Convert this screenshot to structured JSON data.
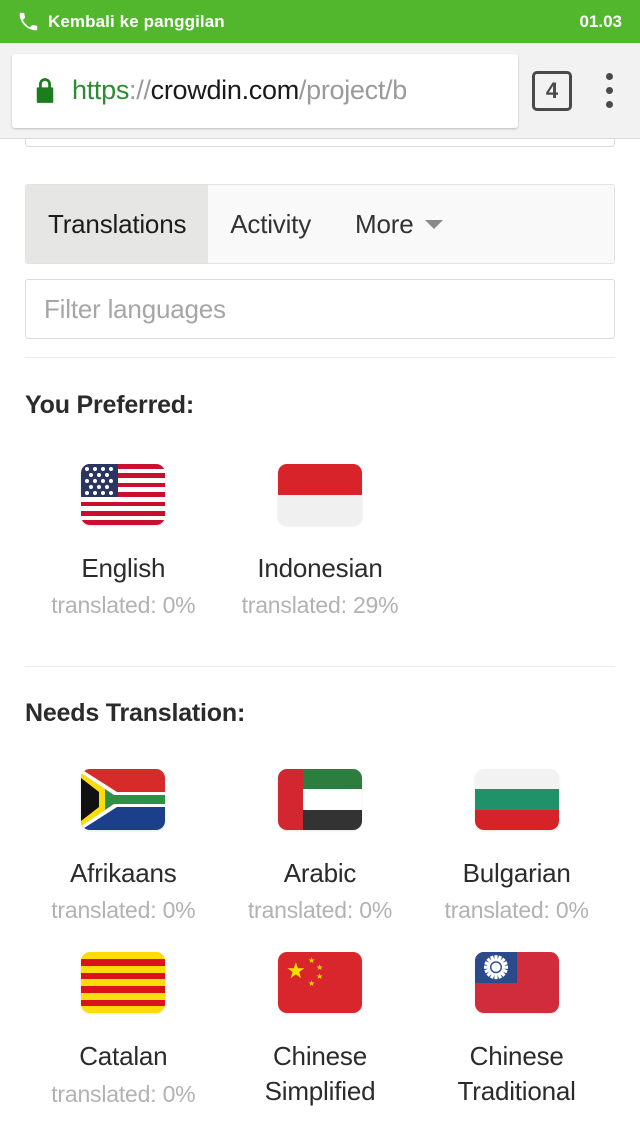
{
  "call_banner": {
    "icon": "phone-icon",
    "label": "Kembali ke panggilan",
    "time": "01.03",
    "color": "#52b72c"
  },
  "browser": {
    "lock_icon": "lock-icon",
    "url": {
      "scheme": "https",
      "separator": "://",
      "host": "crowdin.com",
      "path": "/project/b"
    },
    "tab_count": "4",
    "overflow_icon": "more-vertical-icon"
  },
  "tabs": [
    {
      "label": "Translations",
      "active": true
    },
    {
      "label": "Activity",
      "active": false
    },
    {
      "label": "More",
      "active": false,
      "caret": "chevron-down-icon"
    }
  ],
  "filter": {
    "placeholder": "Filter languages",
    "value": ""
  },
  "sections": [
    {
      "title": "You Preferred:",
      "languages": [
        {
          "name": "English",
          "flag": "flag-united-states",
          "progress": "translated: 0%"
        },
        {
          "name": "Indonesian",
          "flag": "flag-indonesia",
          "progress": "translated: 29%"
        }
      ]
    },
    {
      "title": "Needs Translation:",
      "languages": [
        {
          "name": "Afrikaans",
          "flag": "flag-south-africa",
          "progress": "translated: 0%"
        },
        {
          "name": "Arabic",
          "flag": "flag-united-arab-emirates",
          "progress": "translated: 0%"
        },
        {
          "name": "Bulgarian",
          "flag": "flag-bulgaria",
          "progress": "translated: 0%"
        },
        {
          "name": "Catalan",
          "flag": "flag-catalonia",
          "progress": "translated: 0%"
        },
        {
          "name": "Chinese Simplified",
          "flag": "flag-china",
          "progress": ""
        },
        {
          "name": "Chinese Traditional",
          "flag": "flag-taiwan",
          "progress": ""
        }
      ]
    }
  ],
  "colors": {
    "banner_green": "#52b72c",
    "secure_green": "#2e8b31",
    "active_tab_bg": "#e6e6e4",
    "muted_text": "#b2b2b2"
  }
}
